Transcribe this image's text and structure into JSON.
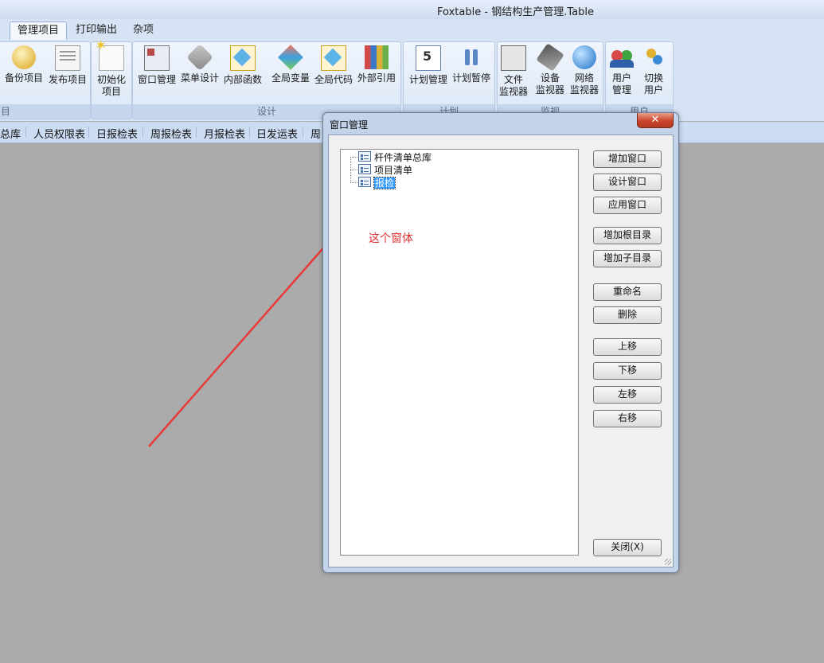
{
  "window": {
    "title": "Foxtable - 钢结构生产管理.Table"
  },
  "tabs": [
    {
      "label": "管理项目",
      "active": true
    },
    {
      "label": "打印输出",
      "active": false
    },
    {
      "label": "杂项",
      "active": false
    }
  ],
  "ribbon": {
    "groups": [
      {
        "label": "目",
        "buttons": [
          {
            "label": "备份项目",
            "icon": "backup-disk-icon"
          },
          {
            "label": "发布项目",
            "icon": "publish-server-icon"
          }
        ]
      },
      {
        "label": "",
        "buttons": [
          {
            "label": "初始化\n项目",
            "icon": "init-project-icon"
          }
        ]
      },
      {
        "label": "设计",
        "buttons": [
          {
            "label": "窗口管理",
            "icon": "window-manage-icon"
          },
          {
            "label": "菜单设计",
            "icon": "menu-design-icon"
          },
          {
            "label": "内部函数",
            "icon": "internal-function-icon"
          },
          {
            "label": "全局变量",
            "icon": "global-variable-icon"
          },
          {
            "label": "全局代码",
            "icon": "global-code-icon"
          },
          {
            "label": "外部引用",
            "icon": "external-reference-icon"
          }
        ]
      },
      {
        "label": "计划",
        "buttons": [
          {
            "label": "计划管理",
            "icon": "plan-calendar-icon"
          },
          {
            "label": "计划暂停",
            "icon": "pause-icon"
          }
        ]
      },
      {
        "label": "监视",
        "buttons": [
          {
            "label": "文件\n监视器",
            "icon": "file-monitor-icon"
          },
          {
            "label": "设备\n监视器",
            "icon": "device-monitor-icon"
          },
          {
            "label": "网络\n监视器",
            "icon": "network-globe-icon"
          }
        ]
      },
      {
        "label": "用户",
        "buttons": [
          {
            "label": "用户\n管理",
            "icon": "users-icon"
          },
          {
            "label": "切换\n用户",
            "icon": "switch-user-icon"
          }
        ]
      }
    ]
  },
  "nav_tabs": [
    "总库",
    "人员权限表",
    "日报检表",
    "周报检表",
    "月报检表",
    "日发运表",
    "周"
  ],
  "dialog": {
    "title": "窗口管理",
    "close_glyph": "✕",
    "tree": [
      "杆件清单总库",
      "项目清单",
      "报检"
    ],
    "selected_index": 2,
    "buttons": {
      "add_window": "增加窗口",
      "design_window": "设计窗口",
      "apply_window": "应用窗口",
      "add_root_dir": "增加根目录",
      "add_sub_dir": "增加子目录",
      "rename": "重命名",
      "delete": "删除",
      "move_up": "上移",
      "move_down": "下移",
      "move_left": "左移",
      "move_right": "右移",
      "close": "关闭(X)"
    }
  },
  "annotation": {
    "text": "这个窗体",
    "color": "#e03030"
  },
  "colors": {
    "accent": "#3399ff",
    "ribbon_bg": "#d6e3f4",
    "workspace": "#ababab"
  }
}
